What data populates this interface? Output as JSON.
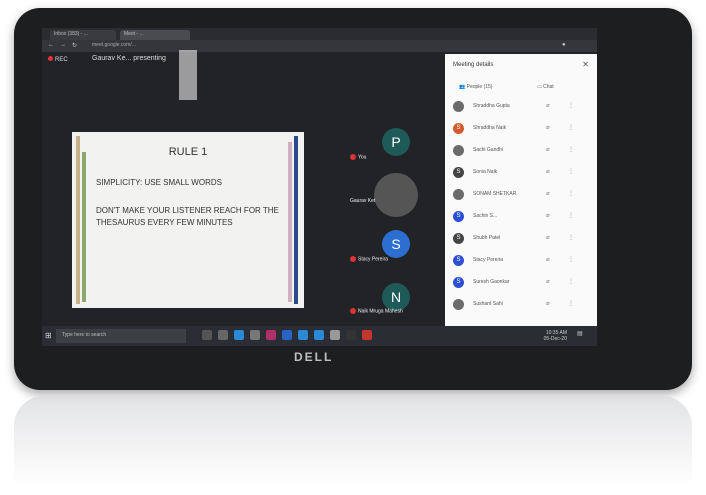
{
  "browser": {
    "tabs": [
      "Inbox (383) - ...",
      "Meet - ..."
    ],
    "url": "meet.google.com/..."
  },
  "meeting": {
    "rec_label": "REC",
    "presenting_text": "Gaurav Ke... presenting"
  },
  "slide": {
    "title": "RULE 1",
    "line1": "SIMPLICITY: USE SMALL WORDS",
    "line2a": "DON'T MAKE YOUR LISTENER REACH FOR THE",
    "line2b": "THESAURUS EVERY FEW MINUTES"
  },
  "tiles": [
    {
      "letter": "P",
      "name": "You",
      "color": "#1e5b58"
    },
    {
      "letter": "",
      "name": "Gaurav Ket",
      "color": "#555555"
    },
    {
      "letter": "S",
      "name": "Stacy Pereira",
      "color": "#2d6fd1"
    },
    {
      "letter": "N",
      "name": "Naik Mruga Mahesh",
      "color": "#1e5b58"
    }
  ],
  "panel": {
    "title": "Meeting details",
    "tab_people": "People (15)",
    "tab_chat": "Chat",
    "people": [
      {
        "initial": "",
        "name": "Shraddha Gupta",
        "color": "#6b6b6b"
      },
      {
        "initial": "S",
        "name": "Shraddha Naik",
        "color": "#d15b2d"
      },
      {
        "initial": "",
        "name": "Sachi Gandhi",
        "color": "#6b6b6b"
      },
      {
        "initial": "S",
        "name": "Sonia Naik",
        "color": "#444444"
      },
      {
        "initial": "",
        "name": "SONAM SHETKAR",
        "color": "#6b6b6b"
      },
      {
        "initial": "S",
        "name": "Sachin S...",
        "color": "#2d4fd1"
      },
      {
        "initial": "S",
        "name": "Shubh Patel",
        "color": "#444444"
      },
      {
        "initial": "S",
        "name": "Stacy Pereira",
        "color": "#2d4fd1"
      },
      {
        "initial": "S",
        "name": "Suresh Gaonkar",
        "color": "#2d4fd1"
      },
      {
        "initial": "",
        "name": "Sushant Sahi",
        "color": "#6b6b6b"
      }
    ]
  },
  "taskbar": {
    "search_placeholder": "Type here to search",
    "time": "10:35 AM",
    "date": "05-Dec-20"
  },
  "brand": "DELL"
}
